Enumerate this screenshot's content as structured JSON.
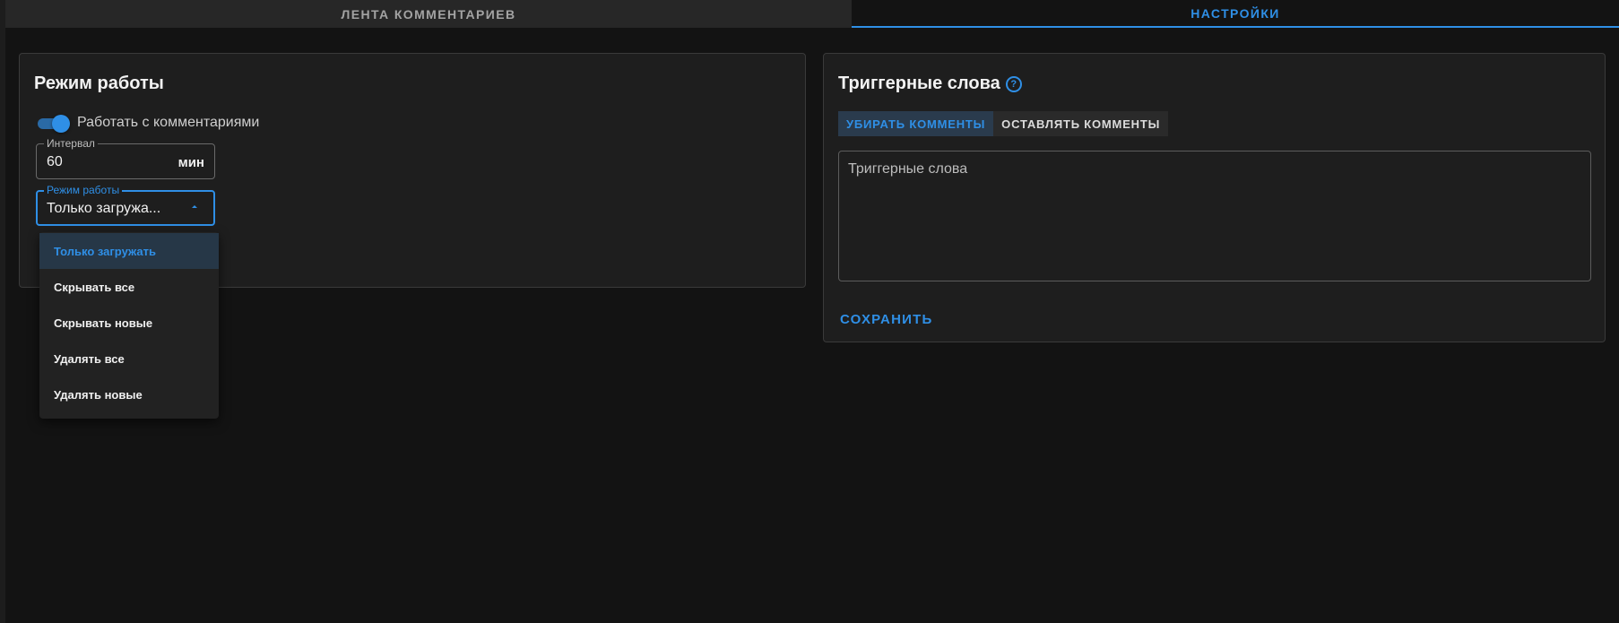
{
  "tabs": {
    "feed": "ЛЕНТА КОММЕНТАРИЕВ",
    "settings": "НАСТРОЙКИ",
    "active": "settings"
  },
  "mode_card": {
    "title": "Режим работы",
    "toggle": {
      "label": "Работать с комментариями",
      "on": true
    },
    "interval": {
      "label": "Интервал",
      "value": "60",
      "unit": "мин"
    },
    "mode_select": {
      "label": "Режим работы",
      "value": "Только загружа...",
      "open": true,
      "options": [
        "Только загружать",
        "Скрывать все",
        "Скрывать новые",
        "Удалять все",
        "Удалять новые"
      ],
      "selected_index": 0
    }
  },
  "trigger_card": {
    "title": "Триггерные слова",
    "help_icon": "help-circle-icon",
    "subtabs": {
      "remove": "УБИРАТЬ КОММЕНТЫ",
      "keep": "ОСТАВЛЯТЬ КОММЕНТЫ",
      "active": "remove"
    },
    "textarea": {
      "placeholder": "Триггерные слова",
      "value": ""
    },
    "save_label": "СОХРАНИТЬ"
  },
  "colors": {
    "accent": "#2f8fe6",
    "background": "#131313",
    "card": "#1e1e1e"
  }
}
